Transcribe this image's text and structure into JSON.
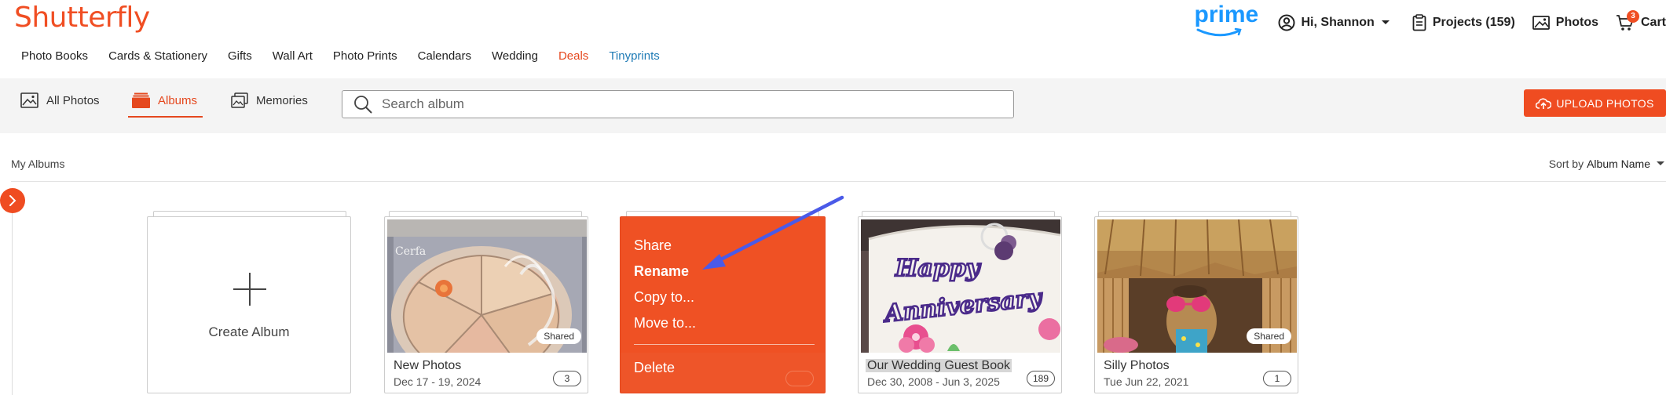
{
  "brand": {
    "logo_text": "Shutterfly",
    "accent": "#f04e23"
  },
  "nav": {
    "items": [
      {
        "label": "Photo Books"
      },
      {
        "label": "Cards & Stationery"
      },
      {
        "label": "Gifts"
      },
      {
        "label": "Wall Art"
      },
      {
        "label": "Photo Prints"
      },
      {
        "label": "Calendars"
      },
      {
        "label": "Wedding"
      },
      {
        "label": "Deals",
        "color": "#e5481e"
      },
      {
        "label": "Tinyprints",
        "color": "#1d7ab5"
      }
    ]
  },
  "header": {
    "prime_label": "prime",
    "account_label": "Hi, Shannon",
    "projects_label": "Projects (159)",
    "photos_label": "Photos",
    "cart_label": "Cart",
    "cart_count": "3"
  },
  "toolbar": {
    "all_photos": "All Photos",
    "albums": "Albums",
    "memories": "Memories",
    "search_placeholder": "Search album",
    "upload_label": "UPLOAD PHOTOS"
  },
  "section": {
    "title": "My Albums",
    "sort_prefix": "Sort by",
    "sort_value": "Album Name"
  },
  "create_album": {
    "label": "Create Album"
  },
  "albums": [
    {
      "title": "New Photos",
      "date": "Dec 17 - 19, 2024",
      "count": "3",
      "shared": "Shared"
    },
    {
      "title": "Our Wedding Guest Book",
      "date": "Dec 30, 2008 - Jun 3, 2025",
      "count": "189"
    },
    {
      "title": "Silly Photos",
      "date": "Tue Jun 22, 2021",
      "count": "1",
      "shared": "Shared"
    }
  ],
  "context_menu": {
    "items": [
      "Share",
      "Rename",
      "Copy to...",
      "Move to...",
      "Delete"
    ]
  },
  "thumb_text": {
    "cerfa": "Cerfa",
    "happy": "Happy",
    "anniversary": "Anniversary"
  }
}
